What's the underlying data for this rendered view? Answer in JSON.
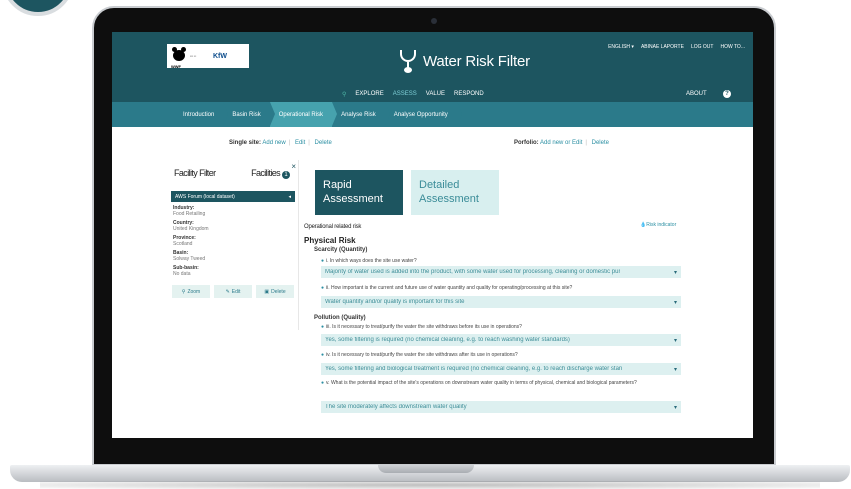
{
  "app": {
    "title": "Water Risk Filter",
    "logos": {
      "wwf": "WWF",
      "kfw": "KfW"
    }
  },
  "utility_nav": [
    "ENGLISH ▾",
    "ABINAE LAPORTE",
    "LOG OUT",
    "HOW TO..."
  ],
  "main_nav": [
    "EXPLORE",
    "ASSESS",
    "VALUE",
    "RESPOND"
  ],
  "main_nav_active": "ASSESS",
  "about": "ABOUT",
  "help_label": "?",
  "steps": [
    "Introduction",
    "Basin Risk",
    "Operational Risk",
    "Analyse Risk",
    "Analyse Opportunity"
  ],
  "current_step": "Operational Risk",
  "site_bar": {
    "single_label": "Single site:",
    "single_add": "Add new",
    "single_edit": "Edit",
    "single_delete": "Delete",
    "portfolio_label": "Porfolio:",
    "portfolio_add": "Add new or Edit",
    "portfolio_delete": "Delete"
  },
  "sidebar": {
    "tab_filter": "Facility Filter",
    "tab_facilities": "Facilities",
    "facilities_count": "1",
    "close": "×",
    "dataset": "AWS Forum (local dataset)",
    "fields": [
      {
        "label": "Industry:",
        "value": "Food Retailing"
      },
      {
        "label": "Country:",
        "value": "United Kingdom"
      },
      {
        "label": "Province:",
        "value": "Scotland"
      },
      {
        "label": "Basin:",
        "value": "Solway Tweed"
      },
      {
        "label": "Sub-basin:",
        "value": "No data"
      }
    ],
    "buttons": {
      "zoom": "Zoom",
      "edit": "Edit",
      "delete": "Delete"
    }
  },
  "assessment_tabs": {
    "rapid": "Rapid Assessment",
    "detailed": "Detailed Assessment"
  },
  "risk_indicator": "Risk indicator",
  "section_label": "Operational related risk",
  "physical_risk": "Physical Risk",
  "groups": {
    "scarcity": "Scarcity (Quantity)",
    "pollution": "Pollution (Quality)"
  },
  "questions": [
    {
      "q": "i. In which ways does the site use water?",
      "a": "Majority of water used is added into the product, with some water used for processing, cleaning or domestic pur"
    },
    {
      "q": "ii. How important is the current and future use of water quantity and quality for operating/processing at this site?",
      "a": "Water quantity and/or quality is important for this site"
    },
    {
      "q": "iii. Is it necessary to treat/purify the water the site withdraws before its use in operations?",
      "a": "Yes, some filtering is required (no chemical cleaning, e.g. to reach washing water standards)"
    },
    {
      "q": "iv. Is it necessary to treat/purify the water the site withdraws after its use in operations?",
      "a": "Yes, some filtering and biological treatment is required (no chemical cleaning, e.g. to reach discharge water stan"
    },
    {
      "q": "v. What is the potential impact of the site's operations on downstream water quality in terms of physical, chemical and biological parameters?",
      "a": "The site moderately affects downstream water quality"
    }
  ],
  "colors": {
    "header": "#1d5560",
    "steps": "#2b7a8a",
    "accent": "#46a2ae",
    "answer_bg": "#ddf0f0"
  }
}
